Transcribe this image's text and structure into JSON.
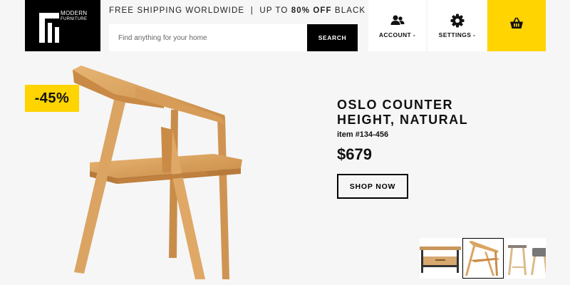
{
  "logo": {
    "line1": "MODERN",
    "line2": "FURNITURE"
  },
  "promo": {
    "text": "FREE SHIPPING WORLDWIDE  |  UP TO ",
    "bold": "80% OFF",
    "suffix": " BLACK FRIDAY"
  },
  "search": {
    "placeholder": "Find anything for your home",
    "button_label": "SEARCH"
  },
  "account": {
    "label": "ACCOUNT -",
    "icon": "users-icon"
  },
  "settings": {
    "label": "SETTINGS -",
    "icon": "gear-icon"
  },
  "cart": {
    "icon": "basket-icon"
  },
  "hero": {
    "discount": "-45%",
    "title_line1": "OSLO COUNTER",
    "title_line2": "HEIGHT, NATURAL",
    "item": "item #134-456",
    "price": "$679",
    "cta": "SHOP NOW"
  },
  "thumbnails": [
    {
      "name": "console-table",
      "selected": false
    },
    {
      "name": "oak-chair",
      "selected": true
    },
    {
      "name": "stools",
      "selected": false
    }
  ],
  "colors": {
    "accent": "#ffd400",
    "dark": "#000000",
    "background": "#f6f6f6",
    "wood": "#d9a15c"
  }
}
